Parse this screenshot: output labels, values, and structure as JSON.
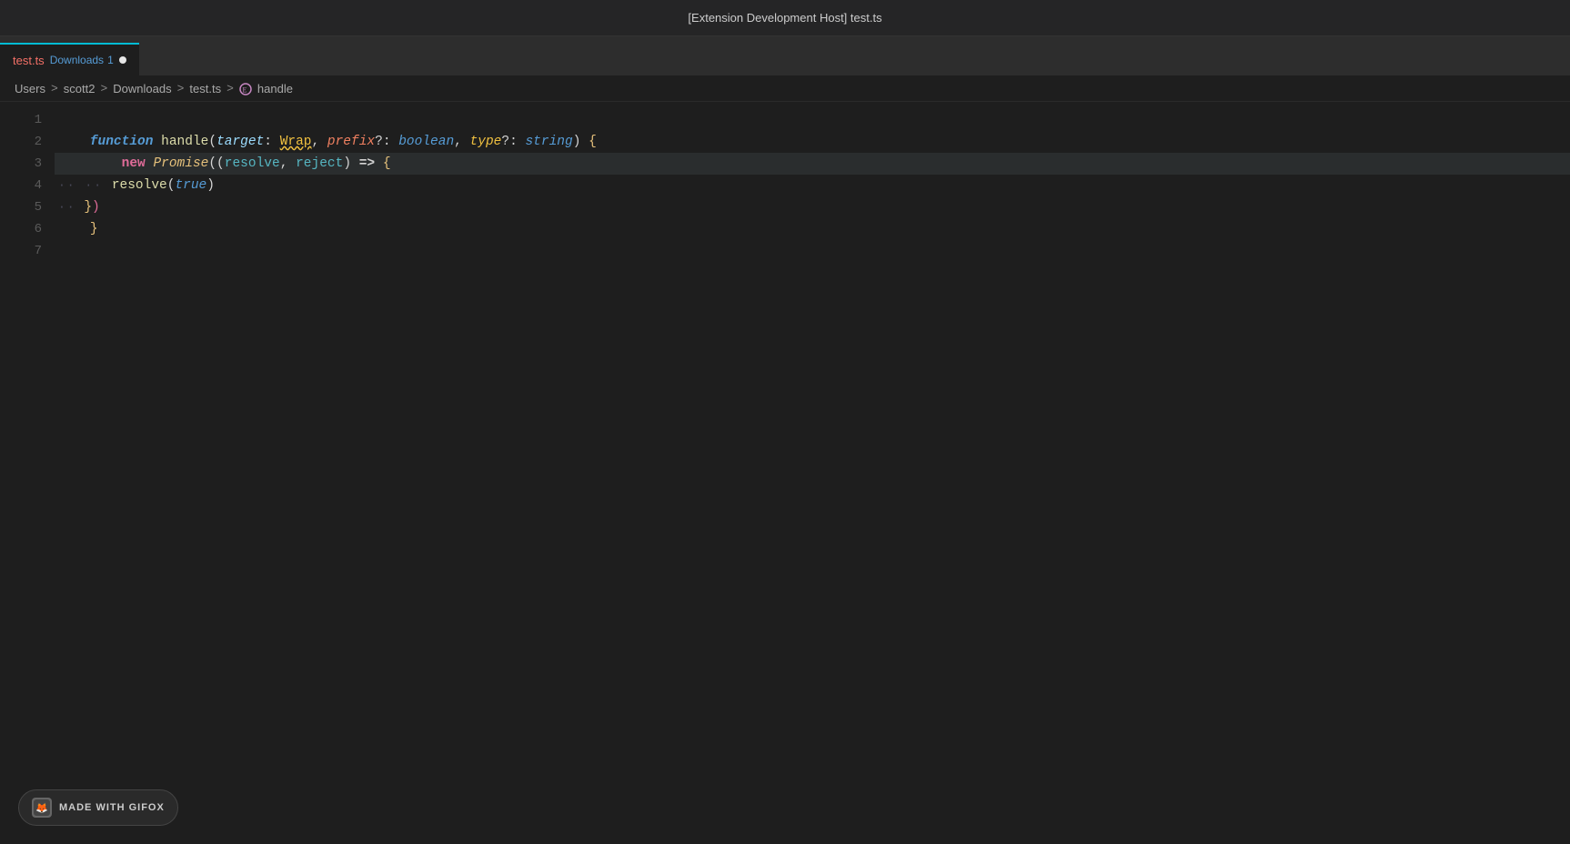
{
  "titleBar": {
    "text": "[Extension Development Host] test.ts"
  },
  "tab": {
    "filename": "test.ts",
    "badge_label": "Downloads",
    "badge_count": "1",
    "has_dot": true,
    "filename_color": "#f47067",
    "badge_color": "#569cd6"
  },
  "breadcrumb": {
    "items": [
      "Users",
      "scott2",
      "Downloads",
      "test.ts",
      "handle"
    ],
    "separators": [
      ">",
      ">",
      ">",
      ">"
    ]
  },
  "lines": {
    "numbers": [
      "1",
      "2",
      "3",
      "4",
      "5",
      "6",
      "7"
    ]
  },
  "gifox": {
    "label": "MADE WITH GIFOX"
  }
}
